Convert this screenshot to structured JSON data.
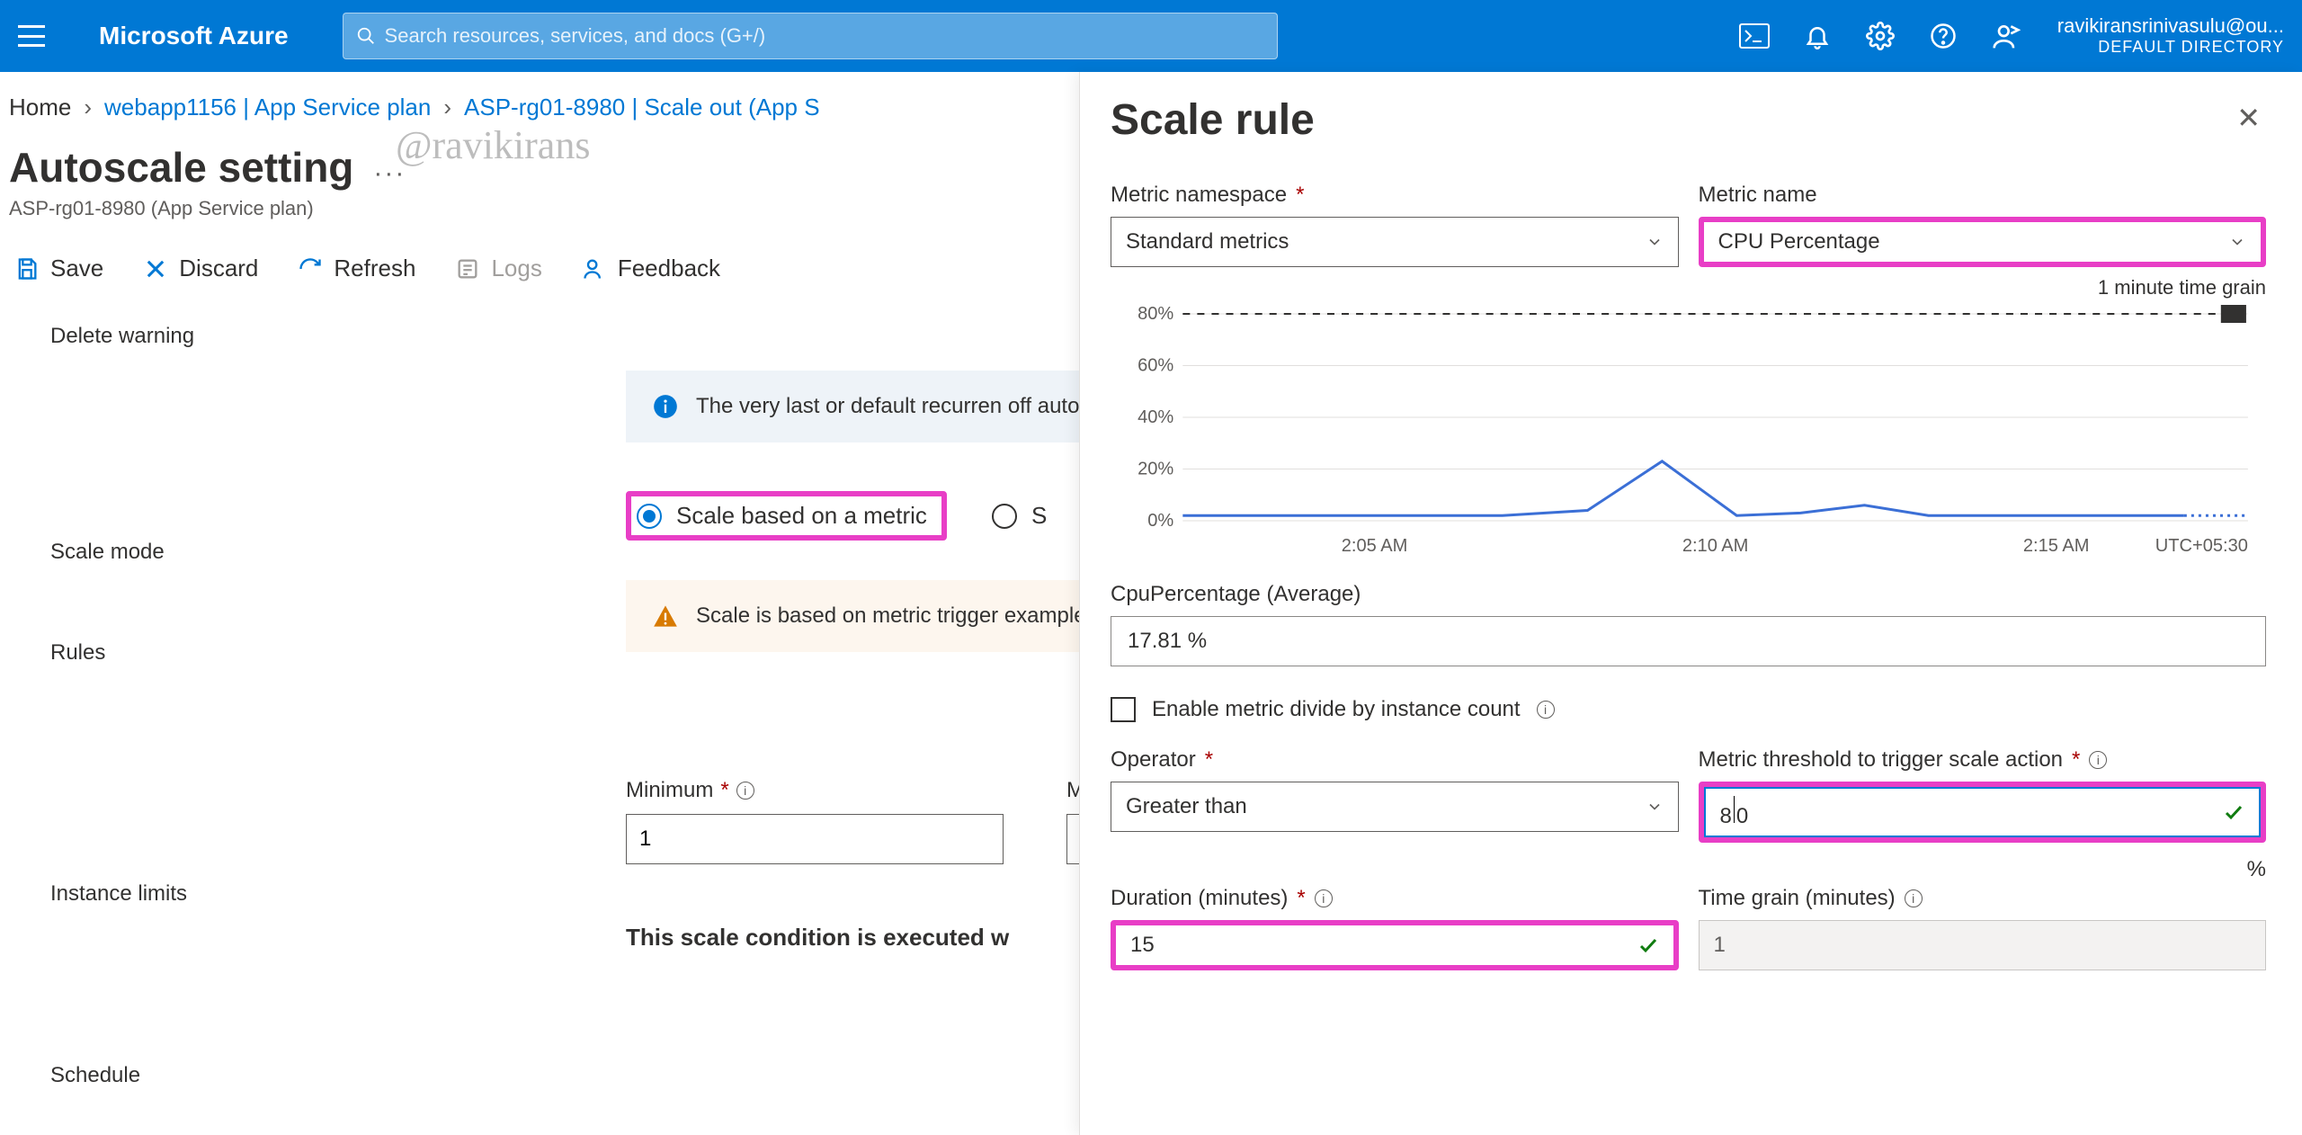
{
  "header": {
    "brand": "Microsoft Azure",
    "search_placeholder": "Search resources, services, and docs (G+/)",
    "user_email": "ravikiransrinivasulu@ou...",
    "user_directory": "DEFAULT DIRECTORY"
  },
  "breadcrumb": {
    "home": "Home",
    "item1": "webapp1156 | App Service plan",
    "item2": "ASP-rg01-8980 | Scale out (App S"
  },
  "watermark": "@ravikirans",
  "page": {
    "title": "Autoscale setting",
    "subtitle": "ASP-rg01-8980 (App Service plan)"
  },
  "toolbar": {
    "save": "Save",
    "discard": "Discard",
    "refresh": "Refresh",
    "logs": "Logs",
    "feedback": "Feedback"
  },
  "left_labels": {
    "delete_warning": "Delete warning",
    "scale_mode": "Scale mode",
    "rules": "Rules",
    "instance_limits": "Instance limits",
    "schedule": "Schedule"
  },
  "main": {
    "info_text": "The very last or default recurren off autoscale.",
    "radio_metric": "Scale based on a metric",
    "radio_other_prefix": "S",
    "warn_text": "Scale is based on metric trigger example: 'Add a rule that increa rules is defined, the resource wi",
    "min_label": "Minimum",
    "min_value": "1",
    "max_label_prefix": "M",
    "schedule_text": "This scale condition is executed w"
  },
  "panel": {
    "title": "Scale rule",
    "metric_namespace_label": "Metric namespace",
    "metric_namespace_value": "Standard metrics",
    "metric_name_label": "Metric name",
    "metric_name_value": "CPU Percentage",
    "time_grain_note": "1 minute time grain",
    "metric_series_label": "CpuPercentage (Average)",
    "metric_series_value": "17.81 %",
    "divide_label": "Enable metric divide by instance count",
    "operator_label": "Operator",
    "operator_value": "Greater than",
    "threshold_label": "Metric threshold to trigger scale action",
    "threshold_value": "80",
    "threshold_display_before": "8",
    "threshold_display_after": "0",
    "threshold_unit": "%",
    "duration_label": "Duration (minutes)",
    "duration_value": "15",
    "timegrain_label": "Time grain (minutes)",
    "timegrain_value": "1"
  },
  "chart_data": {
    "type": "line",
    "ylim": [
      0,
      80
    ],
    "y_ticks": [
      "0%",
      "20%",
      "40%",
      "60%",
      "80%"
    ],
    "x_ticks": [
      "2:05 AM",
      "2:10 AM",
      "2:15 AM"
    ],
    "tz": "UTC+05:30",
    "threshold": 80,
    "series": [
      {
        "name": "CpuPercentage (Average)",
        "points": [
          {
            "x": 0.0,
            "y": 2
          },
          {
            "x": 0.1,
            "y": 2
          },
          {
            "x": 0.2,
            "y": 2
          },
          {
            "x": 0.3,
            "y": 2
          },
          {
            "x": 0.38,
            "y": 4
          },
          {
            "x": 0.45,
            "y": 23
          },
          {
            "x": 0.52,
            "y": 2
          },
          {
            "x": 0.58,
            "y": 3
          },
          {
            "x": 0.64,
            "y": 6
          },
          {
            "x": 0.7,
            "y": 2
          },
          {
            "x": 0.78,
            "y": 2
          },
          {
            "x": 0.86,
            "y": 2
          },
          {
            "x": 0.94,
            "y": 2
          }
        ]
      }
    ]
  }
}
